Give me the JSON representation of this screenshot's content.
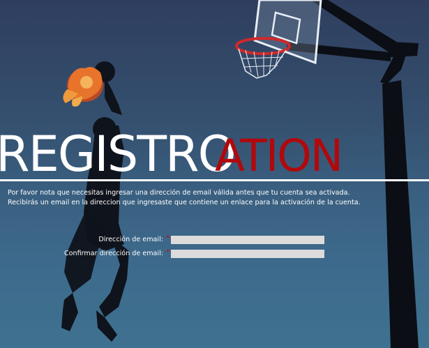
{
  "page": {
    "title_text": "REGISTRO",
    "title_overlay_text": "ATION",
    "notice_line_1": "Por favor nota que necesitas ingresar una dirección de email válida antes que tu cuenta sea activada.",
    "notice_line_2": "Recibirás un email en la direccion que ingresaste que contiene un enlace para la activación de la cuenta."
  },
  "form": {
    "email": {
      "label": "Dirección de email:",
      "required_mark": "*",
      "value": ""
    },
    "confirm_email": {
      "label": "Confirmar dirección de email:",
      "required_mark": "*",
      "value": ""
    }
  },
  "colors": {
    "background_top": "#2f3e5e",
    "background_bottom": "#3f7190",
    "accent_red": "#b0090c",
    "required_red": "#c0101a",
    "field_bg": "#dcdcdc"
  }
}
